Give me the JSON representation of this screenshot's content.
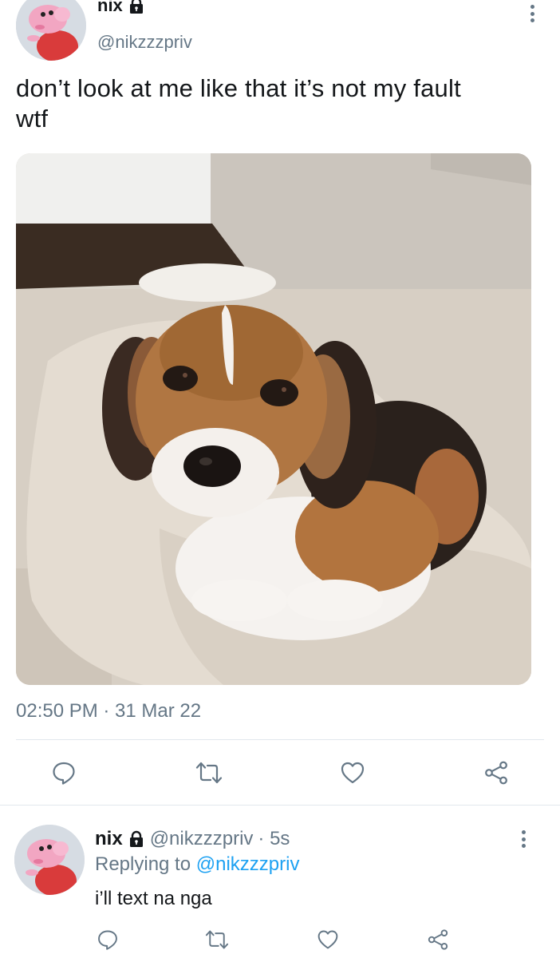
{
  "tweet": {
    "author_name": "nix",
    "author_handle": "@nikzzzpriv",
    "text_line1": "don’t look at me like that it’s not my fault",
    "text_line2": "wtf",
    "timestamp": "02:50 PM · 31 Mar 22",
    "icons": {
      "lock": "lock-icon",
      "more": "more-vertical-icon",
      "reply": "reply-icon",
      "retweet": "retweet-icon",
      "like": "heart-icon",
      "share": "share-icon"
    }
  },
  "reply": {
    "author_name": "nix",
    "author_handle": "@nikzzzpriv",
    "age": "· 5s",
    "replying_prefix": "Replying to",
    "replying_handle": "@nikzzzpriv",
    "text": "i’ll text na nga"
  },
  "colors": {
    "text": "#14171a",
    "secondary": "#657786",
    "link": "#1da1f2",
    "divider": "#e1e8ed"
  }
}
